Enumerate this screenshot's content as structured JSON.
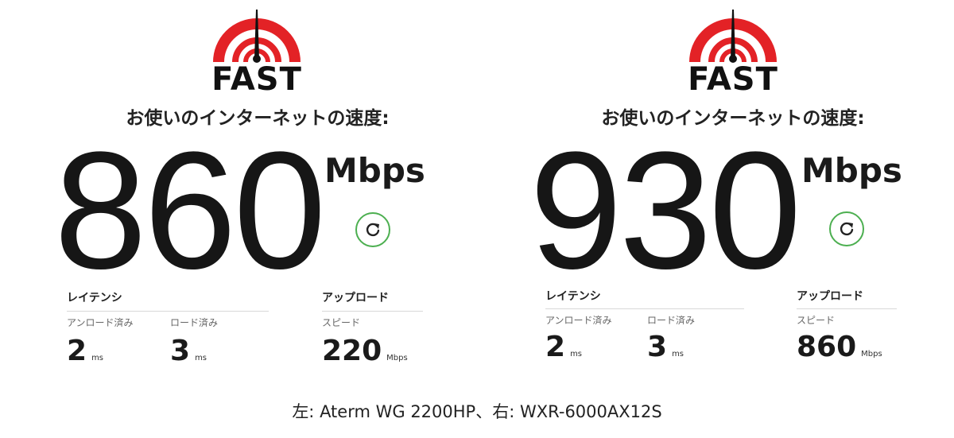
{
  "panels": [
    {
      "logo_text": "FAST",
      "heading": "お使いのインターネットの速度:",
      "speed_value": "860",
      "speed_units": "Mbps",
      "latency": {
        "title": "レイテンシ",
        "unloaded_label": "アンロード済み",
        "unloaded_value": "2",
        "unloaded_unit": "ms",
        "loaded_label": "ロード済み",
        "loaded_value": "3",
        "loaded_unit": "ms"
      },
      "upload": {
        "title": "アップロード",
        "speed_label": "スピード",
        "speed_value": "220",
        "speed_unit": "Mbps"
      }
    },
    {
      "logo_text": "FAST",
      "heading": "お使いのインターネットの速度:",
      "speed_value": "930",
      "speed_units": "Mbps",
      "latency": {
        "title": "レイテンシ",
        "unloaded_label": "アンロード済み",
        "unloaded_value": "2",
        "unloaded_unit": "ms",
        "loaded_label": "ロード済み",
        "loaded_value": "3",
        "loaded_unit": "ms"
      },
      "upload": {
        "title": "アップロード",
        "speed_label": "スピード",
        "speed_value": "860",
        "speed_unit": "Mbps"
      }
    }
  ],
  "caption": "左: Aterm WG 2200HP、右: WXR-6000AX12S",
  "icons": {
    "logo": "speedometer-gauge-icon",
    "refresh": "refresh-icon"
  },
  "colors": {
    "logo_red": "#e32226",
    "refresh_green": "#4caf50",
    "text": "#1a1a1a"
  }
}
